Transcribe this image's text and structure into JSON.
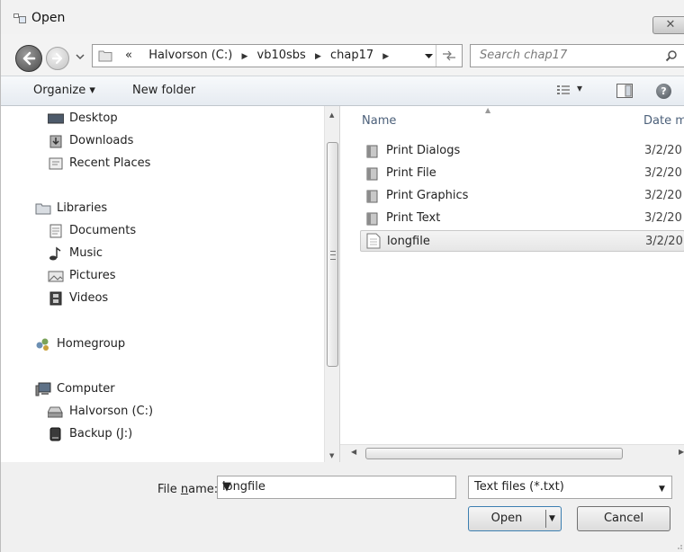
{
  "window": {
    "title": "Open",
    "close_label": "✕"
  },
  "address": {
    "crumbs": [
      "«",
      "Halvorson (C:)",
      "vb10sbs",
      "chap17"
    ]
  },
  "search": {
    "placeholder": "Search chap17"
  },
  "toolbar": {
    "organize": "Organize ▾",
    "new_folder": "New folder",
    "views_dd": "▾"
  },
  "nav": {
    "items": [
      {
        "label": "Desktop",
        "icon": "desktop-icon"
      },
      {
        "label": "Downloads",
        "icon": "downloads-icon"
      },
      {
        "label": "Recent Places",
        "icon": "recent-places-icon"
      },
      {
        "label": "Libraries",
        "icon": "libraries-icon"
      },
      {
        "label": "Documents",
        "icon": "documents-icon"
      },
      {
        "label": "Music",
        "icon": "music-icon"
      },
      {
        "label": "Pictures",
        "icon": "pictures-icon"
      },
      {
        "label": "Videos",
        "icon": "videos-icon"
      },
      {
        "label": "Homegroup",
        "icon": "homegroup-icon"
      },
      {
        "label": "Computer",
        "icon": "computer-icon"
      },
      {
        "label": "Halvorson (C:)",
        "icon": "drive-icon"
      },
      {
        "label": "Backup (J:)",
        "icon": "drive-icon"
      }
    ],
    "selected": "Halvorson (C:)"
  },
  "files": {
    "columns": {
      "name": "Name",
      "date": "Date m"
    },
    "rows": [
      {
        "name": "Print Dialogs",
        "date": "3/2/20",
        "type": "folder"
      },
      {
        "name": "Print File",
        "date": "3/2/20",
        "type": "folder"
      },
      {
        "name": "Print Graphics",
        "date": "3/2/20",
        "type": "folder"
      },
      {
        "name": "Print Text",
        "date": "3/2/20",
        "type": "folder"
      },
      {
        "name": "longfile",
        "date": "3/2/20",
        "type": "text-file",
        "selected": true
      }
    ]
  },
  "footer": {
    "file_name_label_pre": "File ",
    "file_name_label_u": "n",
    "file_name_label_post": "ame:",
    "file_name_value": "longfile",
    "filter_value": "Text files (*.txt)",
    "open_label": "Open",
    "cancel_label": "Cancel"
  },
  "colors": {
    "accent_border": "#3c7fb1",
    "toolbar_bg": "#e6ebf1",
    "header_text": "#4c607a"
  }
}
